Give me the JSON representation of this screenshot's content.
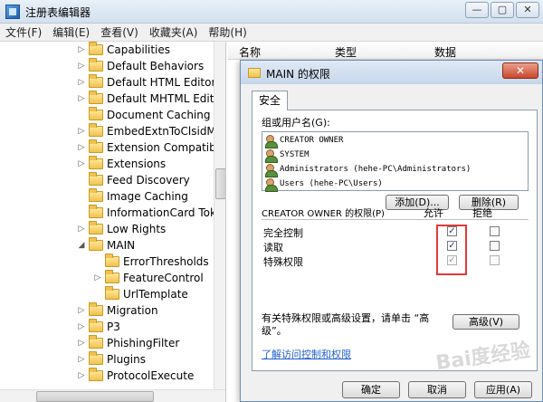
{
  "window": {
    "title": "注册表编辑器",
    "buttons": [
      "—",
      "▢",
      "✕"
    ]
  },
  "menu": [
    "文件(F)",
    "编辑(E)",
    "查看(V)",
    "收藏夹(A)",
    "帮助(H)"
  ],
  "tree": {
    "items": [
      {
        "label": "Capabilities",
        "expander": "▷",
        "depth": 0
      },
      {
        "label": "Default Behaviors",
        "expander": "▷",
        "depth": 0
      },
      {
        "label": "Default HTML Editor",
        "expander": "▷",
        "depth": 0
      },
      {
        "label": "Default MHTML Editor",
        "expander": "▷",
        "depth": 0
      },
      {
        "label": "Document Caching",
        "expander": "",
        "depth": 0
      },
      {
        "label": "EmbedExtnToClsidMap",
        "expander": "▷",
        "depth": 0
      },
      {
        "label": "Extension Compatibility",
        "expander": "▷",
        "depth": 0
      },
      {
        "label": "Extensions",
        "expander": "▷",
        "depth": 0
      },
      {
        "label": "Feed Discovery",
        "expander": "",
        "depth": 0
      },
      {
        "label": "Image Caching",
        "expander": "",
        "depth": 0
      },
      {
        "label": "InformationCard Toker",
        "expander": "",
        "depth": 0
      },
      {
        "label": "Low Rights",
        "expander": "▷",
        "depth": 0
      },
      {
        "label": "MAIN",
        "expander": "◢",
        "depth": 0
      },
      {
        "label": "ErrorThresholds",
        "expander": "",
        "depth": 1
      },
      {
        "label": "FeatureControl",
        "expander": "▷",
        "depth": 1
      },
      {
        "label": "UrlTemplate",
        "expander": "",
        "depth": 1
      },
      {
        "label": "Migration",
        "expander": "▷",
        "depth": 0
      },
      {
        "label": "P3",
        "expander": "▷",
        "depth": 0
      },
      {
        "label": "PhishingFilter",
        "expander": "▷",
        "depth": 0
      },
      {
        "label": "Plugins",
        "expander": "▷",
        "depth": 0
      },
      {
        "label": "ProtocolExecute",
        "expander": "▷",
        "depth": 0
      }
    ]
  },
  "list": {
    "columns": [
      "名称",
      "类型",
      "数据"
    ]
  },
  "dialog": {
    "title": "MAIN 的权限",
    "close": "✕",
    "tab": "安全",
    "group_label": "组或用户名(G):",
    "users": [
      "CREATOR OWNER",
      "SYSTEM",
      "Administrators (hehe-PC\\Administrators)",
      "Users (hehe-PC\\Users)"
    ],
    "add_button": "添加(D)...",
    "remove_button": "删除(R)",
    "perm_label": "CREATOR OWNER 的权限(P)",
    "allow_header": "允许",
    "deny_header": "拒绝",
    "permissions": [
      {
        "name": "完全控制",
        "allow": "✓",
        "deny": ""
      },
      {
        "name": "读取",
        "allow": "✓",
        "deny": ""
      },
      {
        "name": "特殊权限",
        "allow": "✓",
        "deny": ""
      }
    ],
    "advanced_note_line1": "有关特殊权限或高级设置，请单击 “高",
    "advanced_note_line2": "级”。",
    "advanced_button": "高级(V)",
    "access_link": "了解访问控制和权限",
    "ok_button": "确定",
    "cancel_button": "取消",
    "apply_button": "应用(A)"
  },
  "watermark": "Bai度经验"
}
